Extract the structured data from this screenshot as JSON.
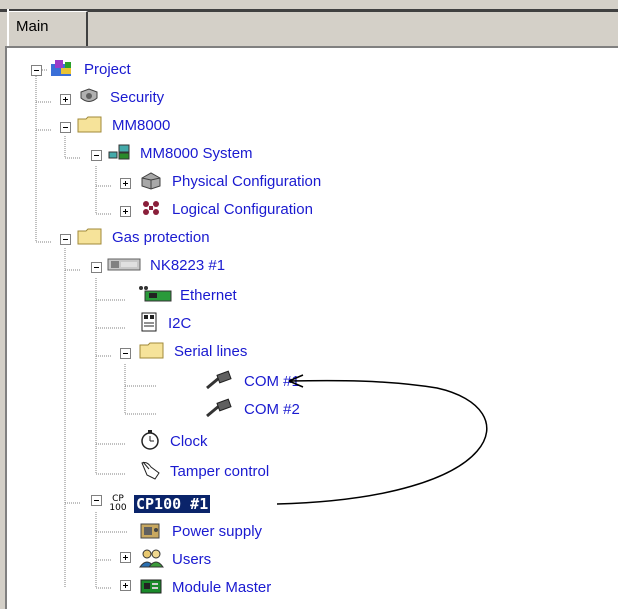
{
  "tabs": [
    {
      "label": "Main"
    }
  ],
  "tree": {
    "project": "Project",
    "security": "Security",
    "mm8000": "MM8000",
    "mm8000_system": "MM8000 System",
    "physical_configuration": "Physical Configuration",
    "logical_configuration": "Logical Configuration",
    "gas_protection": "Gas protection",
    "nk8223": "NK8223 #1",
    "ethernet": "Ethernet",
    "i2c": "I2C",
    "serial_lines": "Serial lines",
    "com1": "COM #1",
    "com2": "COM #2",
    "clock": "Clock",
    "tamper_control": "Tamper control",
    "cp100": "CP100 #1",
    "cp100_icon_top": "CP",
    "cp100_icon_bottom": "100",
    "power_supply": "Power supply",
    "users": "Users",
    "module_master": "Module Master"
  },
  "colors": {
    "tree_text": "#1a1ad0",
    "selection": "#0a246a",
    "folder": "#f6e39a"
  }
}
